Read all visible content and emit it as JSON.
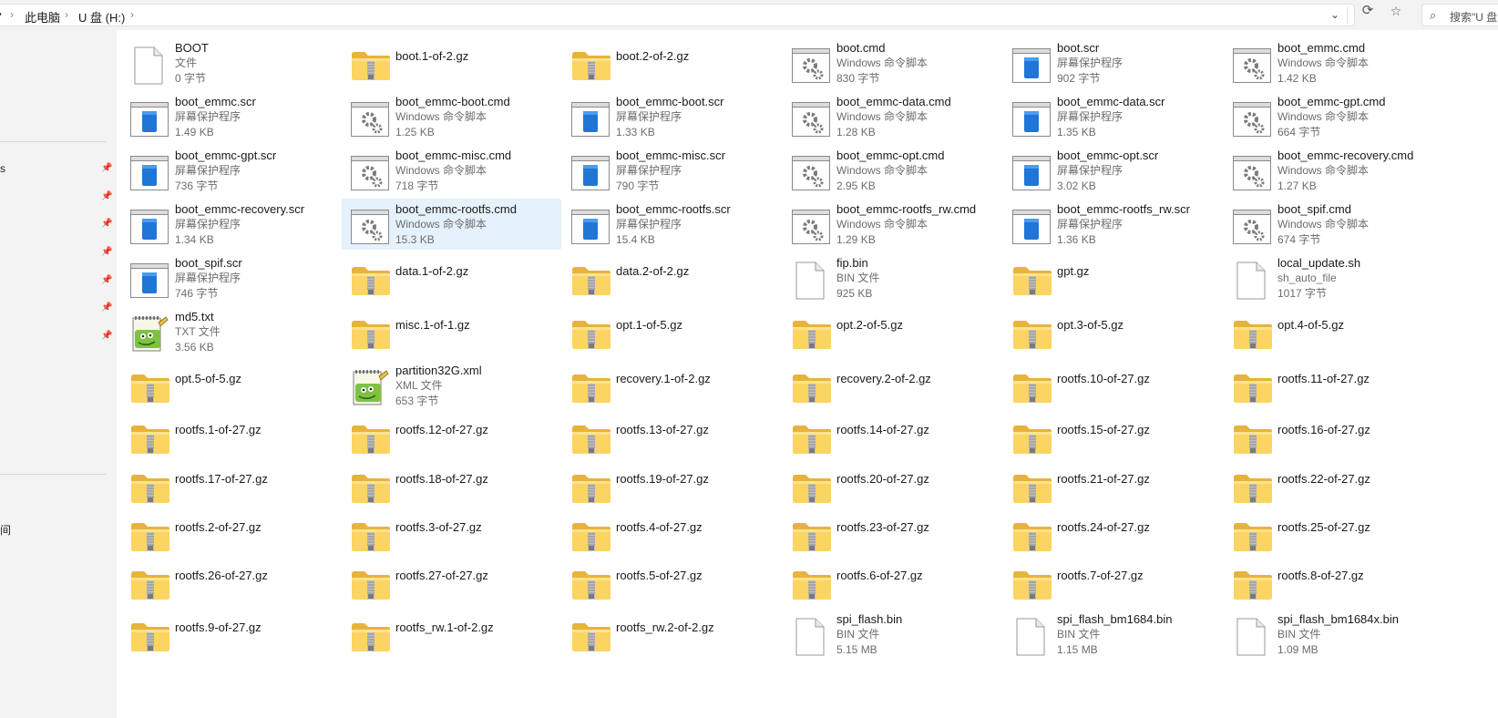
{
  "address": {
    "crumbs": [
      "此电脑",
      "U 盘 (H:)"
    ]
  },
  "search": {
    "placeholder": "搜索\"U 盘"
  },
  "nav": {
    "partial_label": "间"
  },
  "files": [
    {
      "name": "BOOT",
      "type": "文件",
      "size": "0 字节",
      "icon": "blank"
    },
    {
      "name": "boot.1-of-2.gz",
      "icon": "zip"
    },
    {
      "name": "boot.2-of-2.gz",
      "icon": "zip"
    },
    {
      "name": "boot.cmd",
      "type": "Windows 命令脚本",
      "size": "830 字节",
      "icon": "cmd"
    },
    {
      "name": "boot.scr",
      "type": "屏幕保护程序",
      "size": "902 字节",
      "icon": "scr"
    },
    {
      "name": "boot_emmc.cmd",
      "type": "Windows 命令脚本",
      "size": "1.42 KB",
      "icon": "cmd"
    },
    {
      "name": "boot_emmc.scr",
      "type": "屏幕保护程序",
      "size": "1.49 KB",
      "icon": "scr"
    },
    {
      "name": "boot_emmc-boot.cmd",
      "type": "Windows 命令脚本",
      "size": "1.25 KB",
      "icon": "cmd"
    },
    {
      "name": "boot_emmc-boot.scr",
      "type": "屏幕保护程序",
      "size": "1.33 KB",
      "icon": "scr"
    },
    {
      "name": "boot_emmc-data.cmd",
      "type": "Windows 命令脚本",
      "size": "1.28 KB",
      "icon": "cmd"
    },
    {
      "name": "boot_emmc-data.scr",
      "type": "屏幕保护程序",
      "size": "1.35 KB",
      "icon": "scr"
    },
    {
      "name": "boot_emmc-gpt.cmd",
      "type": "Windows 命令脚本",
      "size": "664 字节",
      "icon": "cmd"
    },
    {
      "name": "boot_emmc-gpt.scr",
      "type": "屏幕保护程序",
      "size": "736 字节",
      "icon": "scr"
    },
    {
      "name": "boot_emmc-misc.cmd",
      "type": "Windows 命令脚本",
      "size": "718 字节",
      "icon": "cmd"
    },
    {
      "name": "boot_emmc-misc.scr",
      "type": "屏幕保护程序",
      "size": "790 字节",
      "icon": "scr"
    },
    {
      "name": "boot_emmc-opt.cmd",
      "type": "Windows 命令脚本",
      "size": "2.95 KB",
      "icon": "cmd"
    },
    {
      "name": "boot_emmc-opt.scr",
      "type": "屏幕保护程序",
      "size": "3.02 KB",
      "icon": "scr"
    },
    {
      "name": "boot_emmc-recovery.cmd",
      "type": "Windows 命令脚本",
      "size": "1.27 KB",
      "icon": "cmd"
    },
    {
      "name": "boot_emmc-recovery.scr",
      "type": "屏幕保护程序",
      "size": "1.34 KB",
      "icon": "scr"
    },
    {
      "name": "boot_emmc-rootfs.cmd",
      "type": "Windows 命令脚本",
      "size": "15.3 KB",
      "icon": "cmd",
      "selected": true
    },
    {
      "name": "boot_emmc-rootfs.scr",
      "type": "屏幕保护程序",
      "size": "15.4 KB",
      "icon": "scr"
    },
    {
      "name": "boot_emmc-rootfs_rw.cmd",
      "type": "Windows 命令脚本",
      "size": "1.29 KB",
      "icon": "cmd"
    },
    {
      "name": "boot_emmc-rootfs_rw.scr",
      "type": "屏幕保护程序",
      "size": "1.36 KB",
      "icon": "scr"
    },
    {
      "name": "boot_spif.cmd",
      "type": "Windows 命令脚本",
      "size": "674 字节",
      "icon": "cmd"
    },
    {
      "name": "boot_spif.scr",
      "type": "屏幕保护程序",
      "size": "746 字节",
      "icon": "scr"
    },
    {
      "name": "data.1-of-2.gz",
      "icon": "zip"
    },
    {
      "name": "data.2-of-2.gz",
      "icon": "zip"
    },
    {
      "name": "fip.bin",
      "type": "BIN 文件",
      "size": "925 KB",
      "icon": "blank"
    },
    {
      "name": "gpt.gz",
      "icon": "zip"
    },
    {
      "name": "local_update.sh",
      "type": "sh_auto_file",
      "size": "1017 字节",
      "icon": "blank"
    },
    {
      "name": "md5.txt",
      "type": "TXT 文件",
      "size": "3.56 KB",
      "icon": "notepad"
    },
    {
      "name": "misc.1-of-1.gz",
      "icon": "zip"
    },
    {
      "name": "opt.1-of-5.gz",
      "icon": "zip"
    },
    {
      "name": "opt.2-of-5.gz",
      "icon": "zip"
    },
    {
      "name": "opt.3-of-5.gz",
      "icon": "zip"
    },
    {
      "name": "opt.4-of-5.gz",
      "icon": "zip"
    },
    {
      "name": "opt.5-of-5.gz",
      "icon": "zip"
    },
    {
      "name": "partition32G.xml",
      "type": "XML 文件",
      "size": "653 字节",
      "icon": "notepad"
    },
    {
      "name": "recovery.1-of-2.gz",
      "icon": "zip"
    },
    {
      "name": "recovery.2-of-2.gz",
      "icon": "zip"
    },
    {
      "name": "rootfs.10-of-27.gz",
      "icon": "zip"
    },
    {
      "name": "rootfs.11-of-27.gz",
      "icon": "zip"
    },
    {
      "name": "rootfs.1-of-27.gz",
      "icon": "zip"
    },
    {
      "name": "rootfs.12-of-27.gz",
      "icon": "zip"
    },
    {
      "name": "rootfs.13-of-27.gz",
      "icon": "zip"
    },
    {
      "name": "rootfs.14-of-27.gz",
      "icon": "zip"
    },
    {
      "name": "rootfs.15-of-27.gz",
      "icon": "zip"
    },
    {
      "name": "rootfs.16-of-27.gz",
      "icon": "zip"
    },
    {
      "name": "rootfs.17-of-27.gz",
      "icon": "zip"
    },
    {
      "name": "rootfs.18-of-27.gz",
      "icon": "zip"
    },
    {
      "name": "rootfs.19-of-27.gz",
      "icon": "zip"
    },
    {
      "name": "rootfs.20-of-27.gz",
      "icon": "zip"
    },
    {
      "name": "rootfs.21-of-27.gz",
      "icon": "zip"
    },
    {
      "name": "rootfs.22-of-27.gz",
      "icon": "zip"
    },
    {
      "name": "rootfs.2-of-27.gz",
      "icon": "zip"
    },
    {
      "name": "rootfs.3-of-27.gz",
      "icon": "zip"
    },
    {
      "name": "rootfs.4-of-27.gz",
      "icon": "zip"
    },
    {
      "name": "rootfs.23-of-27.gz",
      "icon": "zip"
    },
    {
      "name": "rootfs.24-of-27.gz",
      "icon": "zip"
    },
    {
      "name": "rootfs.25-of-27.gz",
      "icon": "zip"
    },
    {
      "name": "rootfs.26-of-27.gz",
      "icon": "zip"
    },
    {
      "name": "rootfs.27-of-27.gz",
      "icon": "zip"
    },
    {
      "name": "rootfs.5-of-27.gz",
      "icon": "zip"
    },
    {
      "name": "rootfs.6-of-27.gz",
      "icon": "zip"
    },
    {
      "name": "rootfs.7-of-27.gz",
      "icon": "zip"
    },
    {
      "name": "rootfs.8-of-27.gz",
      "icon": "zip"
    },
    {
      "name": "rootfs.9-of-27.gz",
      "icon": "zip"
    },
    {
      "name": "rootfs_rw.1-of-2.gz",
      "icon": "zip"
    },
    {
      "name": "rootfs_rw.2-of-2.gz",
      "icon": "zip"
    },
    {
      "name": "spi_flash.bin",
      "type": "BIN 文件",
      "size": "5.15 MB",
      "icon": "blank"
    },
    {
      "name": "spi_flash_bm1684.bin",
      "type": "BIN 文件",
      "size": "1.15 MB",
      "icon": "blank"
    },
    {
      "name": "spi_flash_bm1684x.bin",
      "type": "BIN 文件",
      "size": "1.09 MB",
      "icon": "blank"
    }
  ]
}
